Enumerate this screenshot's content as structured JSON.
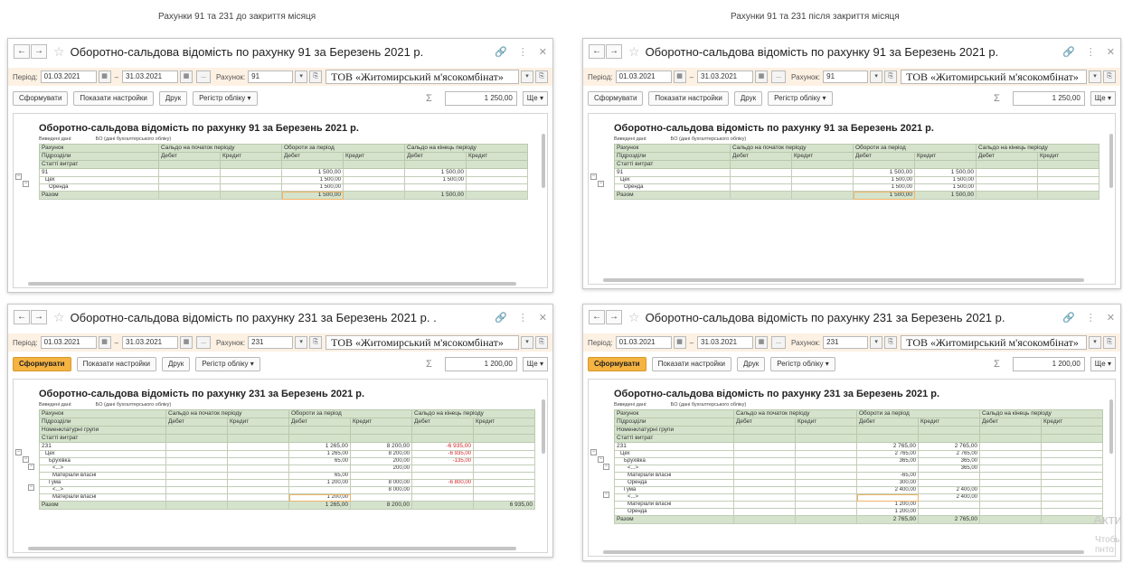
{
  "captions": {
    "left": "Рахунки 91 та 231 до закриття місяця",
    "right": "Рахунки 91 та 231 після закриття місяця"
  },
  "common": {
    "nav_back": "←",
    "nav_forward": "→",
    "period_label": "Період:",
    "date_from": "01.03.2021",
    "date_to": "31.03.2021",
    "dash": "–",
    "ellipsis_btn": "...",
    "account_label": "Рахунок:",
    "org": "ТОВ «Житомирський м'ясокомбінат»",
    "generate": "Сформувати",
    "show_settings": "Показати настройки",
    "print": "Друк",
    "register": "Регістр обліку",
    "more": "Ще",
    "sigma": "Σ",
    "output_label": "Виведені дані:",
    "output_value": "БО (дані бухгалтерського обліку)",
    "hdr_account": "Рахунок",
    "hdr_subdiv": "Підрозділи",
    "hdr_nomen": "Номенклатурні групи",
    "hdr_cost": "Статті витрат",
    "hdr_start": "Сальдо на початок періоду",
    "hdr_turnover": "Обороти за період",
    "hdr_end": "Сальдо на кінець періоду",
    "debit": "Дебет",
    "credit": "Кредит",
    "total": "Разом"
  },
  "windows": [
    {
      "title": "Оборотно-сальдова відомість по рахунку 91 за Березень 2021 р.",
      "account": "91",
      "sum": "1 250,00",
      "report_title": "Оборотно-сальдова відомість по рахунку 91 за Березень 2021 р.",
      "rows": [
        {
          "label": "91",
          "to_d": "1 500,00",
          "to_c": "",
          "end_d": "1 500,00",
          "end_c": ""
        },
        {
          "label": "Цех",
          "to_d": "1 500,00",
          "to_c": "",
          "end_d": "1 500,00",
          "end_c": ""
        },
        {
          "label": "Оренда",
          "to_d": "1 500,00",
          "to_c": "",
          "end_d": "",
          "end_c": ""
        }
      ],
      "total": {
        "to_d": "1 500,00",
        "to_c": "",
        "end_d": "1 500,00",
        "end_c": ""
      }
    },
    {
      "title": "Оборотно-сальдова відомість по рахунку 91 за Березень 2021 р.",
      "account": "91",
      "sum": "1 250,00",
      "report_title": "Оборотно-сальдова відомість по рахунку 91 за Березень 2021 р.",
      "rows": [
        {
          "label": "91",
          "to_d": "1 500,00",
          "to_c": "1 500,00",
          "end_d": "",
          "end_c": ""
        },
        {
          "label": "Цех",
          "to_d": "1 500,00",
          "to_c": "1 500,00",
          "end_d": "",
          "end_c": ""
        },
        {
          "label": "Оренда",
          "to_d": "1 500,00",
          "to_c": "1 500,00",
          "end_d": "",
          "end_c": ""
        }
      ],
      "total": {
        "to_d": "1 500,00",
        "to_c": "1 500,00",
        "end_d": "",
        "end_c": ""
      }
    },
    {
      "title": "Оборотно-сальдова відомість по рахунку 231 за Березень 2021 р. .",
      "account": "231",
      "sum": "1 200,00",
      "report_title": "Оборотно-сальдова відомість по рахунку 231 за Березень 2021 р.",
      "rows": [
        {
          "label": "231",
          "to_d": "1 265,00",
          "to_c": "8 200,00",
          "end_d": "-6 935,00",
          "end_c": ""
        },
        {
          "label": "Цех",
          "to_d": "1 265,00",
          "to_c": "8 200,00",
          "end_d": "-6 935,00",
          "end_c": ""
        },
        {
          "label": "Брухівка",
          "to_d": "65,00",
          "to_c": "200,00",
          "end_d": "-135,00",
          "end_c": ""
        },
        {
          "label": "<...>",
          "to_d": "",
          "to_c": "200,00",
          "end_d": "",
          "end_c": ""
        },
        {
          "label": "Матеріали власні",
          "to_d": "65,00",
          "to_c": "",
          "end_d": "",
          "end_c": ""
        },
        {
          "label": "Гума",
          "to_d": "1 200,00",
          "to_c": "8 000,00",
          "end_d": "-6 800,00",
          "end_c": ""
        },
        {
          "label": "<...>",
          "to_d": "",
          "to_c": "8 000,00",
          "end_d": "",
          "end_c": ""
        },
        {
          "label": "Матеріали власні",
          "to_d": "1 200,00",
          "to_c": "",
          "end_d": "",
          "end_c": ""
        }
      ],
      "total": {
        "to_d": "1 265,00",
        "to_c": "8 200,00",
        "end_d": "",
        "end_c": "6 935,00"
      }
    },
    {
      "title": "Оборотно-сальдова відомість по рахунку 231 за Березень 2021 р.",
      "account": "231",
      "sum": "1 200,00",
      "report_title": "Оборотно-сальдова відомість по рахунку 231 за Березень 2021 р.",
      "rows": [
        {
          "label": "231",
          "to_d": "2 765,00",
          "to_c": "2 765,00",
          "end_d": "",
          "end_c": ""
        },
        {
          "label": "Цех",
          "to_d": "2 765,00",
          "to_c": "2 765,00",
          "end_d": "",
          "end_c": ""
        },
        {
          "label": "Брухівка",
          "to_d": "365,00",
          "to_c": "365,00",
          "end_d": "",
          "end_c": ""
        },
        {
          "label": "<...>",
          "to_d": "",
          "to_c": "365,00",
          "end_d": "",
          "end_c": ""
        },
        {
          "label": "Матеріали власні",
          "to_d": "-65,00",
          "to_c": "",
          "end_d": "",
          "end_c": ""
        },
        {
          "label": "Оренда",
          "to_d": "300,00",
          "to_c": "",
          "end_d": "",
          "end_c": ""
        },
        {
          "label": "Гума",
          "to_d": "2 400,00",
          "to_c": "2 400,00",
          "end_d": "",
          "end_c": ""
        },
        {
          "label": "<...>",
          "to_d": "",
          "to_c": "2 400,00",
          "end_d": "",
          "end_c": ""
        },
        {
          "label": "Матеріали власні",
          "to_d": "1 200,00",
          "to_c": "",
          "end_d": "",
          "end_c": ""
        },
        {
          "label": "Оренда",
          "to_d": "1 200,00",
          "to_c": "",
          "end_d": "",
          "end_c": ""
        }
      ],
      "total": {
        "to_d": "2 765,00",
        "to_c": "2 765,00",
        "end_d": "",
        "end_c": ""
      }
    }
  ],
  "watermark": {
    "line1": "Акти",
    "line2": "Чтобы",
    "line3": "пнто"
  }
}
